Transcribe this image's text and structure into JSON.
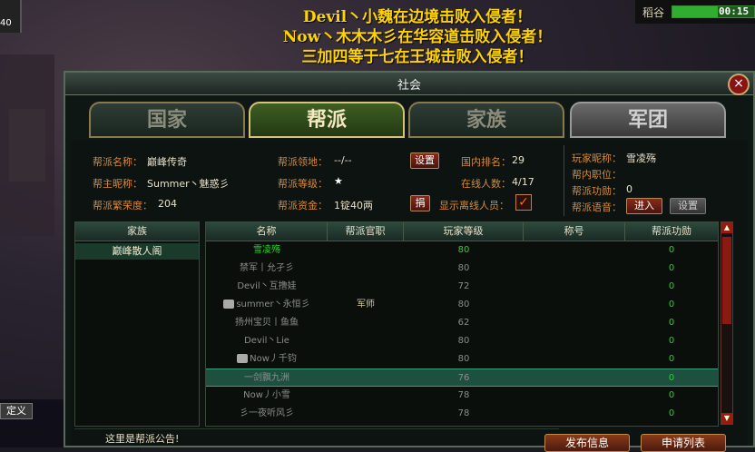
{
  "broadcasts": [
    "Devil丶小魏在边境击败入侵者！",
    "Now丶木木木彡在华容道击败入侵者！",
    "三加四等于七在王城击败入侵者！"
  ],
  "hud": {
    "top_left_level": "40",
    "player_name": "稻谷",
    "time": "00:15",
    "health_fraction": 0.55,
    "chat_button": "定义"
  },
  "panel": {
    "title": "社会",
    "close_label": "×",
    "tabs": [
      {
        "label": "国家",
        "active": false
      },
      {
        "label": "帮派",
        "active": true
      },
      {
        "label": "家族",
        "active": false
      },
      {
        "label": "军团",
        "active": false
      }
    ]
  },
  "guild": {
    "name_label": "帮派名称：",
    "name": "巅峰传奇",
    "leader_label": "帮主昵称：",
    "leader": "Summer丶魅惑彡",
    "prosperity_label": "帮派繁荣度：",
    "prosperity": "204",
    "territory_label": "帮派领地：",
    "territory": "--/--",
    "settings_button": "设置",
    "level_label": "帮派等级：",
    "level": "★",
    "funds_label": "帮派资金：",
    "funds": "1锭40两",
    "donate_button": "捐",
    "rank_label": "国内排名：",
    "rank": "29",
    "online_label": "在线人数：",
    "online": "4/17",
    "show_offline_label": "显示离线人员：",
    "show_offline_checked": true,
    "player_nick_label": "玩家昵称：",
    "player_nick": "雪凌殇",
    "position_label": "帮内职位：",
    "position": "",
    "merit_label": "帮派功勋：",
    "merit": "0",
    "voice_label": "帮派语音：",
    "voice_enter_button": "进入",
    "voice_settings_button": "设置"
  },
  "family_list": {
    "header": "家族",
    "items": [
      "巅峰散人阁"
    ]
  },
  "members": {
    "headers": [
      "名称",
      "帮派官职",
      "玩家等级",
      "称号",
      "帮派功勋"
    ],
    "rows": [
      {
        "name": "雪凌殇",
        "post": "",
        "level": "80",
        "title": "",
        "merit": "0",
        "me": true,
        "avatar": false
      },
      {
        "name": "禁军丨允孑彡",
        "post": "",
        "level": "80",
        "title": "",
        "merit": "0",
        "me": false,
        "avatar": false
      },
      {
        "name": "Devil丶互撸娃",
        "post": "",
        "level": "72",
        "title": "",
        "merit": "0",
        "me": false,
        "avatar": false
      },
      {
        "name": "summer丶永恒彡",
        "post": "军师",
        "level": "80",
        "title": "",
        "merit": "0",
        "me": false,
        "avatar": true
      },
      {
        "name": "扬州宝贝丨鱼鱼",
        "post": "",
        "level": "62",
        "title": "",
        "merit": "0",
        "me": false,
        "avatar": false
      },
      {
        "name": "Devil丶Lie",
        "post": "",
        "level": "80",
        "title": "",
        "merit": "0",
        "me": false,
        "avatar": false
      },
      {
        "name": "Now丿千钧",
        "post": "",
        "level": "80",
        "title": "",
        "merit": "0",
        "me": false,
        "avatar": true
      },
      {
        "name": "一剑飘九洲",
        "post": "",
        "level": "76",
        "title": "",
        "merit": "0",
        "me": false,
        "avatar": false,
        "selected": true
      },
      {
        "name": "Now丿小雪",
        "post": "",
        "level": "78",
        "title": "",
        "merit": "0",
        "me": false,
        "avatar": false
      },
      {
        "name": "彡一夜听风彡",
        "post": "",
        "level": "78",
        "title": "",
        "merit": "0",
        "me": false,
        "avatar": false
      }
    ]
  },
  "notice": "这里是帮派公告!",
  "bottom_buttons": {
    "publish": "发布信息",
    "applications": "申请列表"
  }
}
